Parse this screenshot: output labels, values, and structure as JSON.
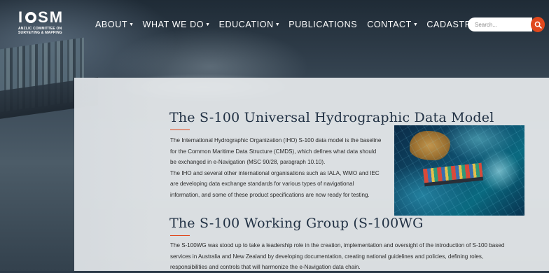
{
  "brand": {
    "logo_text_left": "I",
    "logo_text_right": "SM",
    "logo_subtitle_line1": "ANZLIC COMMITTEE ON",
    "logo_subtitle_line2": "SURVEYING & MAPPING"
  },
  "nav": {
    "items": [
      {
        "label": "ABOUT",
        "has_dropdown": true
      },
      {
        "label": "WHAT WE DO",
        "has_dropdown": true
      },
      {
        "label": "EDUCATION",
        "has_dropdown": true
      },
      {
        "label": "PUBLICATIONS",
        "has_dropdown": false
      },
      {
        "label": "CONTACT",
        "has_dropdown": true
      },
      {
        "label": "CADASTRE 2034",
        "has_dropdown": false
      }
    ],
    "caret": "▼"
  },
  "search": {
    "placeholder": "Search...",
    "icon": "search-icon"
  },
  "sections": [
    {
      "title": "The S-100 Universal Hydrographic Data Model",
      "lines": [
        "The International Hydrographic Organization (IHO) S-100 data model is the baseline",
        "for the Common Maritime Data Structure (CMDS), which defines what data should",
        "be exchanged in e-Navigation (MSC 90/28, paragraph 10.10).",
        "The IHO and several other international organisations such as IALA, WMO and IEC",
        "are developing data exchange standards for various types of navigational",
        "information, and some of these product specifications are now ready for testing."
      ]
    },
    {
      "title": "The S-100 Working Group (S-100WG",
      "lines": [
        "The S-100WG was stood up to take a leadership role in the creation, implementation and oversight of the introduction of S-100 based",
        "services in Australia and New Zealand by developing documentation, creating national guidelines and policies, defining roles,",
        "responsibilities and controls that will harmonize the e-Navigation data chain."
      ]
    }
  ],
  "colors": {
    "accent": "#e0481d",
    "heading": "#1f2f42",
    "card": "#e6e9ec"
  }
}
